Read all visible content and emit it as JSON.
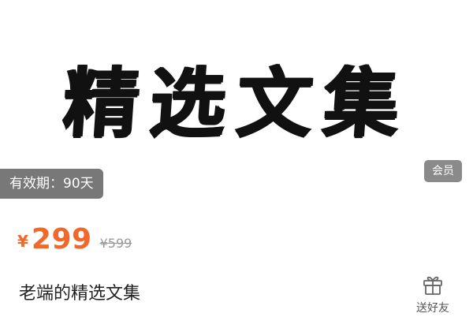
{
  "hero": {
    "title": "精选文集"
  },
  "badges": {
    "validity": "有效期：90天",
    "member": "会员"
  },
  "pricing": {
    "currency": "¥",
    "price": "299",
    "original_price": "¥599"
  },
  "product": {
    "title": "老端的精选文集"
  },
  "actions": {
    "gift_label": "送好友",
    "gift_icon": "gift-icon"
  },
  "colors": {
    "price": "#f2682a",
    "badge_bg": "#5a5a5a",
    "member_bg": "#8a8a8a",
    "muted": "#999999"
  }
}
